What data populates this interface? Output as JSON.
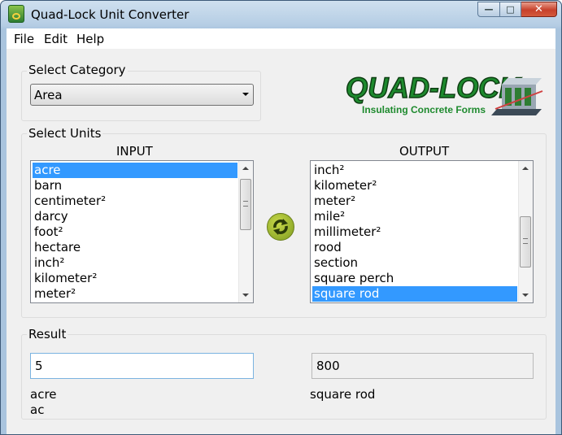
{
  "window": {
    "title": "Quad-Lock Unit Converter"
  },
  "menu": {
    "items": [
      "File",
      "Edit",
      "Help"
    ]
  },
  "category": {
    "group_label": "Select Category",
    "selected": "Area"
  },
  "logo": {
    "brand": "QUAD-LOCK",
    "tagline": "Insulating Concrete Forms",
    "colors": {
      "green": "#1e8a2e",
      "dark": "#0d3d12"
    }
  },
  "units": {
    "group_label": "Select Units",
    "input_header": "INPUT",
    "output_header": "OUTPUT",
    "input_items": [
      "acre",
      "barn",
      "centimeter²",
      "darcy",
      "foot²",
      "hectare",
      "inch²",
      "kilometer²",
      "meter²"
    ],
    "input_selected_index": 0,
    "output_items": [
      "inch²",
      "kilometer²",
      "meter²",
      "mile²",
      "millimeter²",
      "rood",
      "section",
      "square perch",
      "square rod"
    ],
    "output_selected_index": 8
  },
  "result": {
    "group_label": "Result",
    "input_value": "5",
    "output_value": "800",
    "input_unit_name": "acre",
    "input_unit_abbr": "ac",
    "output_unit_name": "square rod"
  },
  "colors": {
    "selection": "#3399ff",
    "client_bg": "#f0f0f0"
  },
  "icons": {
    "swap": "refresh-arrows-icon",
    "app": "quad-lock-app-icon"
  }
}
